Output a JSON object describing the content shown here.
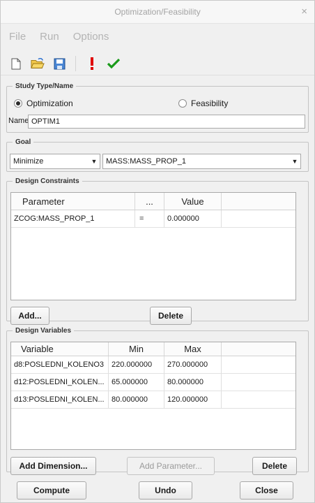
{
  "window": {
    "title": "Optimization/Feasibility",
    "close_glyph": "×"
  },
  "menu": [
    "File",
    "Run",
    "Options"
  ],
  "toolbar": {
    "icons": [
      "new-document-icon",
      "open-folder-icon",
      "save-icon",
      "exclamation-icon",
      "checkmark-icon"
    ]
  },
  "study": {
    "legend": "Study Type/Name",
    "option_optimization": "Optimization",
    "option_feasibility": "Feasibility",
    "selected": "Optimization",
    "name_label": "Name",
    "name_value": "OPTIM1"
  },
  "goal": {
    "legend": "Goal",
    "goal_type": "Minimize",
    "goal_target": "MASS:MASS_PROP_1"
  },
  "constraints": {
    "legend": "Design Constraints",
    "headers": [
      "Parameter",
      "...",
      "Value"
    ],
    "rows": [
      {
        "parameter": "ZCOG:MASS_PROP_1",
        "op": "=",
        "value": "0.000000"
      }
    ],
    "add_label": "Add...",
    "delete_label": "Delete"
  },
  "variables": {
    "legend": "Design Variables",
    "headers": [
      "Variable",
      "Min",
      "Max"
    ],
    "rows": [
      {
        "variable": "d8:POSLEDNI_KOLENO3",
        "min": "220.000000",
        "max": "270.000000"
      },
      {
        "variable": "d12:POSLEDNI_KOLEN...",
        "min": "65.000000",
        "max": "80.000000"
      },
      {
        "variable": "d13:POSLEDNI_KOLEN...",
        "min": "80.000000",
        "max": "120.000000"
      }
    ],
    "add_dimension_label": "Add Dimension...",
    "add_parameter_label": "Add Parameter...",
    "delete_label": "Delete"
  },
  "footer": {
    "compute_label": "Compute",
    "undo_label": "Undo",
    "close_label": "Close"
  },
  "colors": {
    "exclamation": "#e00000",
    "checkmark": "#1a9a1a",
    "folder": "#e8b020",
    "save": "#3a78c8"
  }
}
